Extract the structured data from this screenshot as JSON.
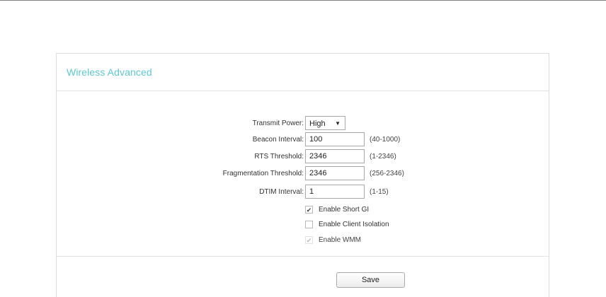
{
  "panel": {
    "title": "Wireless Advanced"
  },
  "form": {
    "transmit_power": {
      "label": "Transmit Power:",
      "value": "High"
    },
    "beacon_interval": {
      "label": "Beacon Interval:",
      "value": "100",
      "range": "(40-1000)"
    },
    "rts_threshold": {
      "label": "RTS Threshold:",
      "value": "2346",
      "range": "(1-2346)"
    },
    "fragmentation_threshold": {
      "label": "Fragmentation Threshold:",
      "value": "2346",
      "range": "(256-2346)"
    },
    "dtim_interval": {
      "label": "DTIM Interval:",
      "value": "1",
      "range": "(1-15)"
    },
    "checkboxes": [
      {
        "label": "Enable Short GI",
        "checked": true,
        "disabled": false
      },
      {
        "label": "Enable Client Isolation",
        "checked": false,
        "disabled": false
      },
      {
        "label": "Enable WMM",
        "checked": true,
        "disabled": true
      }
    ]
  },
  "footer": {
    "save_label": "Save"
  },
  "icons": {
    "dropdown": "chevron-down-icon",
    "check": "checkmark-icon"
  },
  "colors": {
    "title_accent": "#5ec8d1"
  }
}
